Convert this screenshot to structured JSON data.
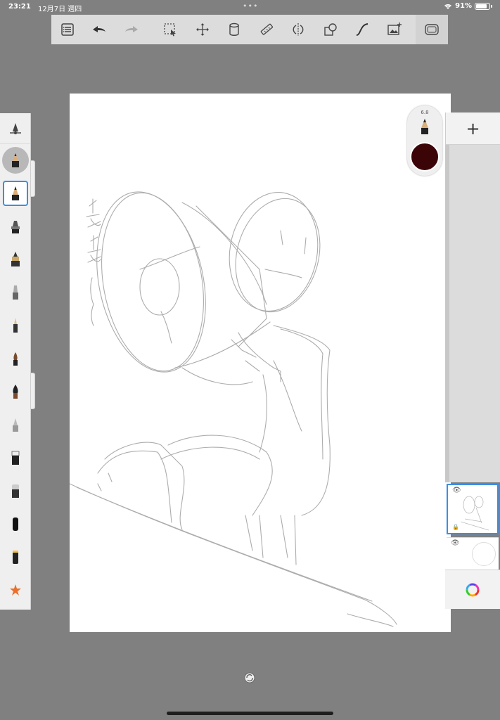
{
  "status": {
    "time": "23:21",
    "date": "12月7日 週四",
    "battery": "91%",
    "battery_level": 0.91
  },
  "toolbar": {
    "items": [
      "list-icon",
      "undo-icon",
      "redo-icon",
      "selection-icon",
      "transform-icon",
      "bucket-icon",
      "ruler-icon",
      "symmetry-icon",
      "shapes-icon",
      "curve-icon",
      "image-icon",
      "fullscreen-icon"
    ]
  },
  "puck": {
    "size": "6.8",
    "color": "#3b0508"
  },
  "canvas": {
    "handwriting": "安安"
  },
  "brushes": [
    "pencil",
    "marker",
    "ink",
    "airbrush",
    "pen",
    "paintbrush",
    "paintbrush-wet",
    "soft-pencil",
    "eraser-hard",
    "eraser-soft",
    "smudge",
    "blender",
    "favorites"
  ],
  "layers": {
    "add_label": "+"
  }
}
